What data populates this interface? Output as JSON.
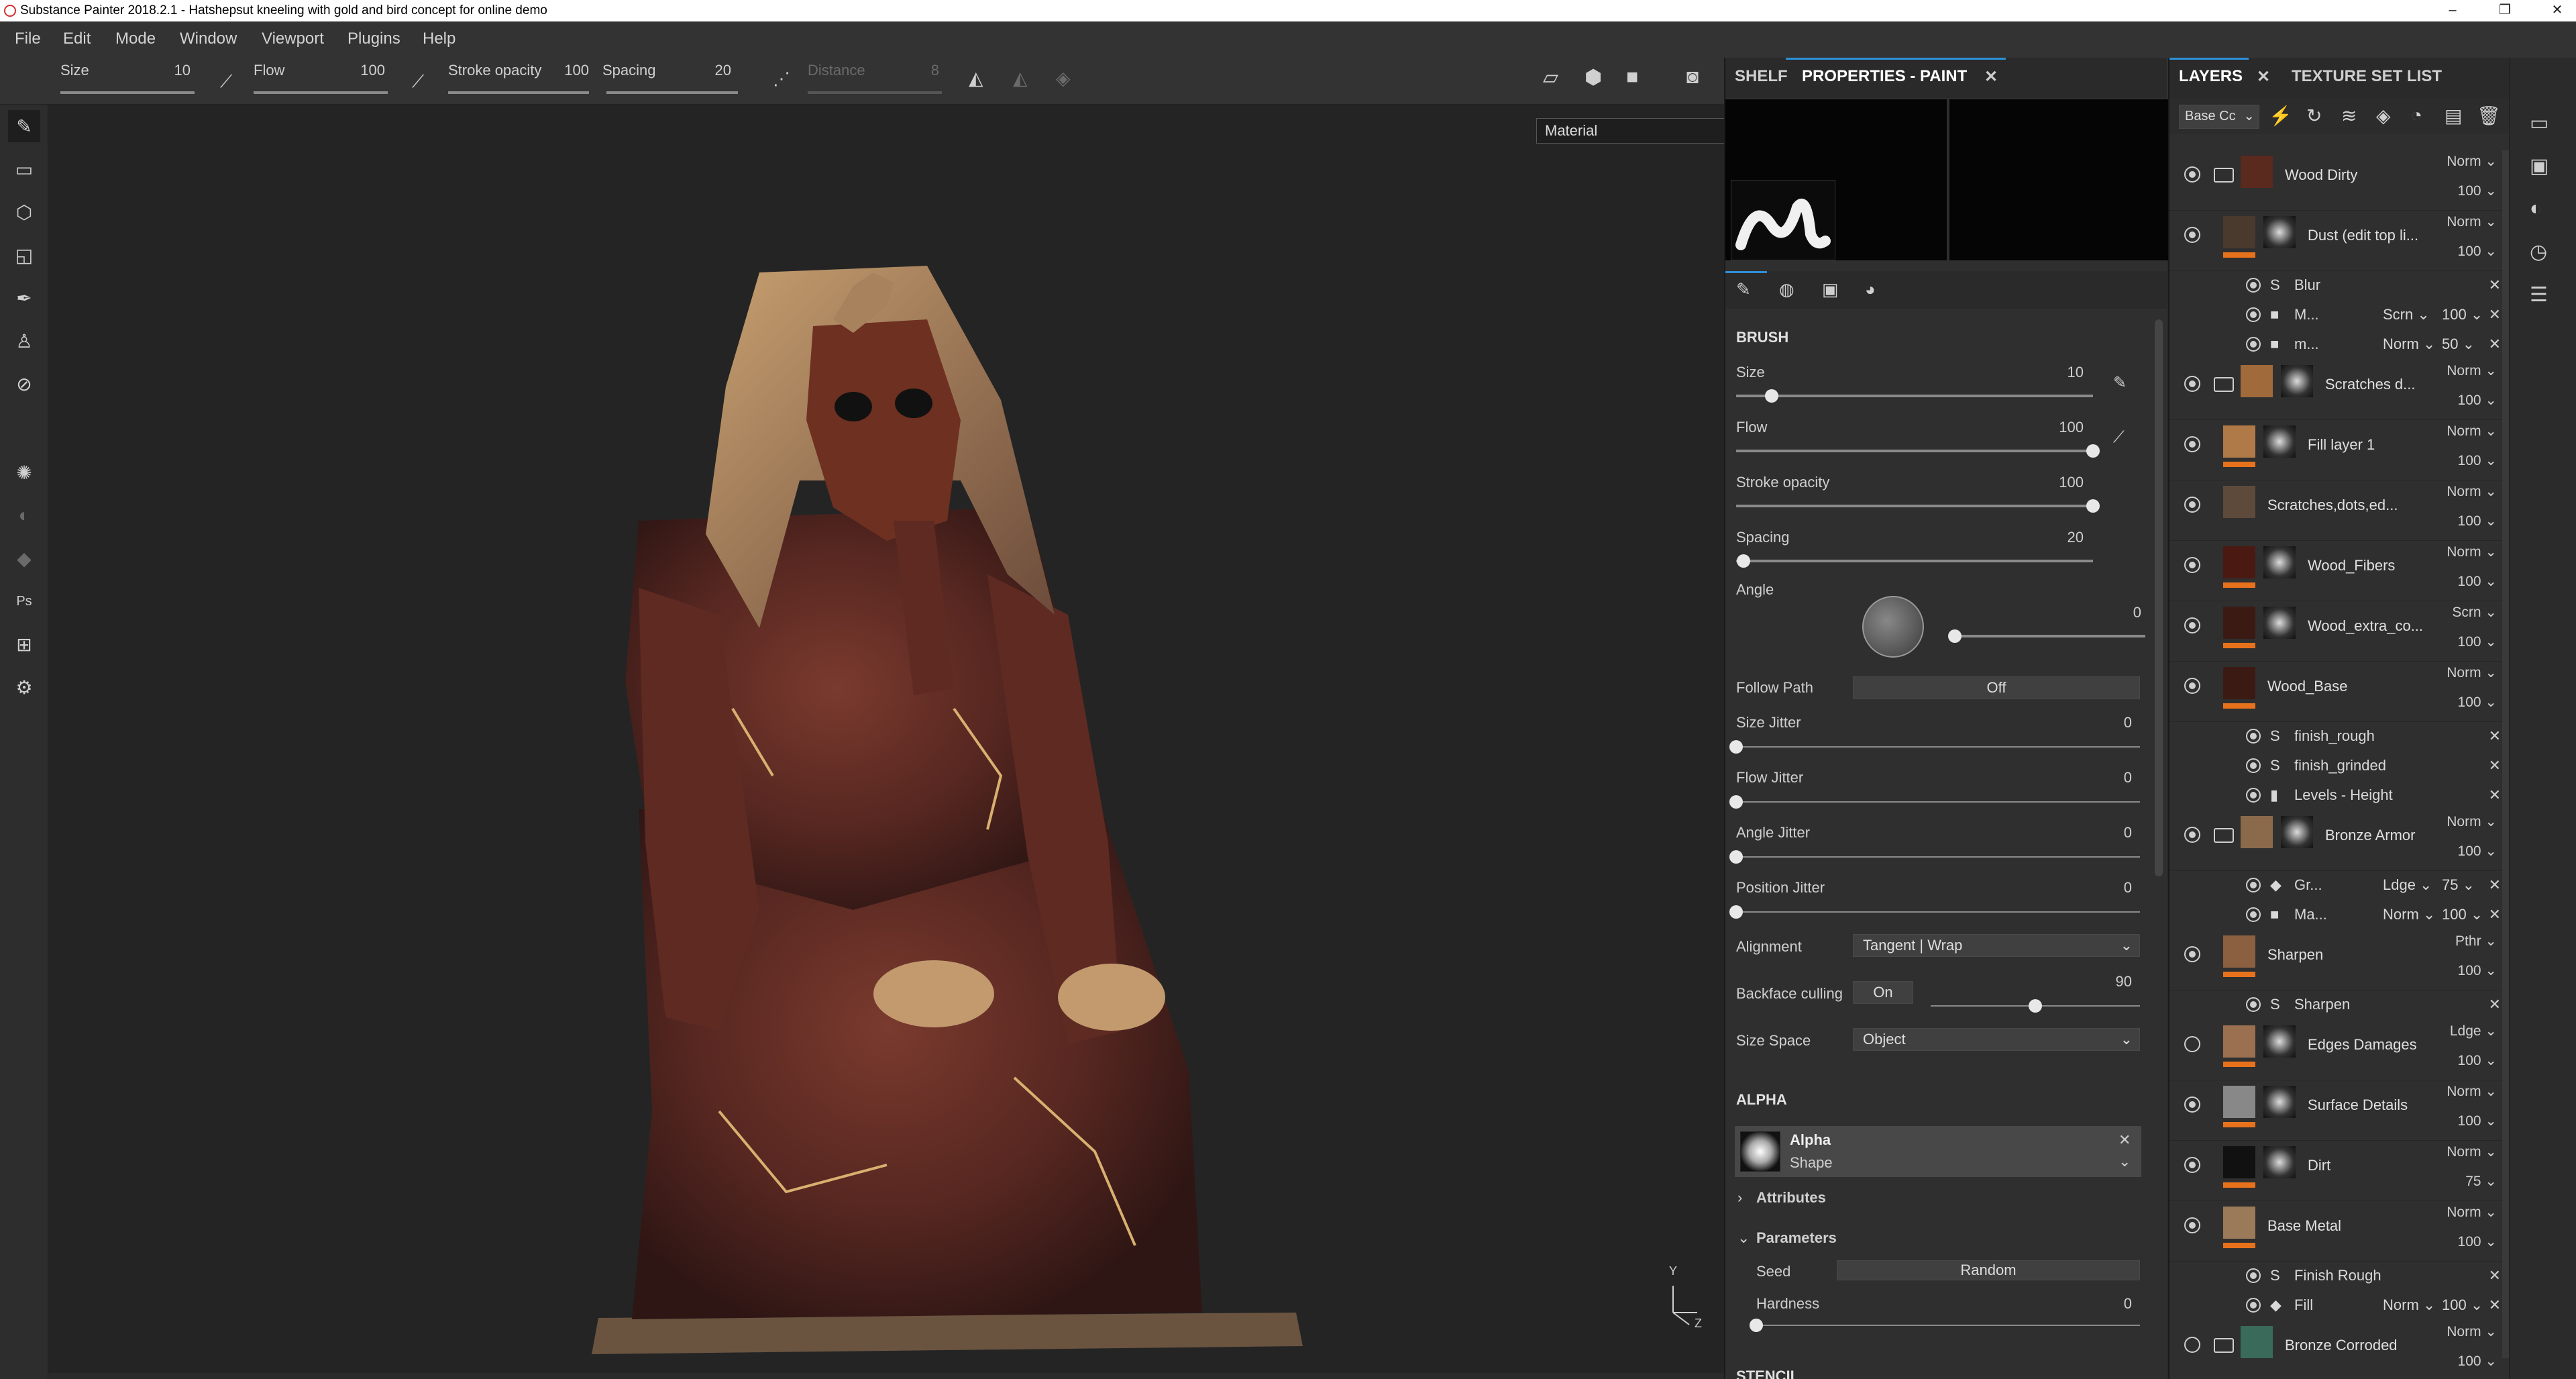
{
  "window": {
    "title": "Substance Painter 2018.2.1 - Hatshepsut kneeling with gold and bird concept for online demo",
    "minimize": "–",
    "restore": "❐",
    "close": "✕"
  },
  "menu": [
    "File",
    "Edit",
    "Mode",
    "Window",
    "Viewport",
    "Plugins",
    "Help"
  ],
  "tool_options": {
    "size_label": "Size",
    "size_value": "10",
    "size_level": 0.1,
    "flow_label": "Flow",
    "flow_value": "100",
    "flow_level": 1.0,
    "stroke_opacity_label": "Stroke opacity",
    "stroke_opacity_value": "100",
    "stroke_opacity_level": 1.0,
    "spacing_label": "Spacing",
    "spacing_value": "20",
    "spacing_level": 0.2,
    "distance_label": "Distance",
    "distance_value": "8",
    "distance_level": 0.08
  },
  "viewport": {
    "channel_select": "Material",
    "axis_y": "Y",
    "axis_z": "Z"
  },
  "shelf_panel": {
    "tab_shelf": "SHELF",
    "tab_properties": "PROPERTIES - PAINT",
    "brush_header": "BRUSH",
    "params": [
      {
        "label": "Size",
        "value": "10",
        "level": 0.1
      },
      {
        "label": "Flow",
        "value": "100",
        "level": 1.0
      },
      {
        "label": "Stroke opacity",
        "value": "100",
        "level": 1.0
      },
      {
        "label": "Spacing",
        "value": "20",
        "level": 0.02
      }
    ],
    "angle_label": "Angle",
    "angle_value": "0",
    "follow_path_label": "Follow Path",
    "follow_path_value": "Off",
    "jitters": [
      {
        "label": "Size Jitter",
        "value": "0",
        "level": 0
      },
      {
        "label": "Flow Jitter",
        "value": "0",
        "level": 0
      },
      {
        "label": "Angle Jitter",
        "value": "0",
        "level": 0
      },
      {
        "label": "Position Jitter",
        "value": "0",
        "level": 0
      }
    ],
    "alignment_label": "Alignment",
    "alignment_value": "Tangent | Wrap",
    "backface_label": "Backface culling",
    "backface_toggle": "On",
    "backface_value": "90",
    "backface_level": 0.5,
    "size_space_label": "Size Space",
    "size_space_value": "Object",
    "alpha_header": "ALPHA",
    "alpha_name": "Alpha",
    "alpha_sub": "Shape",
    "attributes_label": "Attributes",
    "parameters_label": "Parameters",
    "seed_label": "Seed",
    "seed_value": "Random",
    "hardness_label": "Hardness",
    "hardness_value": "0",
    "hardness_level": 0,
    "stencil_header": "STENCIL"
  },
  "layers_panel": {
    "tab_layers": "LAYERS",
    "tab_texture_sets": "TEXTURE SET LIST",
    "channel_select": "Base Cc",
    "items": [
      {
        "kind": "layer",
        "name": "Wood Dirty",
        "blend": "Norm",
        "opacity": "100",
        "visible": true,
        "folder": true,
        "thumb": "#5a2a1e",
        "mask": false,
        "orange": false
      },
      {
        "kind": "layer",
        "name": "Dust (edit top li...",
        "blend": "Norm",
        "opacity": "100",
        "visible": true,
        "folder": false,
        "thumb": "#4a3a2e",
        "mask": true,
        "orange": true
      },
      {
        "kind": "effect",
        "name": "Blur",
        "blend": "",
        "opacity": "",
        "icon": "S"
      },
      {
        "kind": "effect",
        "name": "M...",
        "blend": "Scrn",
        "opacity": "100",
        "icon": "■"
      },
      {
        "kind": "effect",
        "name": "m...",
        "blend": "Norm",
        "opacity": "50",
        "icon": "■"
      },
      {
        "kind": "layer",
        "name": "Scratches d...",
        "blend": "Norm",
        "opacity": "100",
        "visible": true,
        "folder": true,
        "thumb": "#a06a3a",
        "mask": true,
        "orange": false
      },
      {
        "kind": "layer",
        "name": "Fill layer 1",
        "blend": "Norm",
        "opacity": "100",
        "visible": true,
        "folder": false,
        "thumb": "#b07a48",
        "mask": true,
        "orange": true
      },
      {
        "kind": "layer",
        "name": "Scratches,dots,ed...",
        "blend": "Norm",
        "opacity": "100",
        "visible": true,
        "folder": false,
        "thumb": "#5e4a3a",
        "mask": false,
        "orange": false
      },
      {
        "kind": "layer",
        "name": "Wood_Fibers",
        "blend": "Norm",
        "opacity": "100",
        "visible": true,
        "folder": false,
        "thumb": "#4a1a12",
        "mask": true,
        "orange": true
      },
      {
        "kind": "layer",
        "name": "Wood_extra_co...",
        "blend": "Scrn",
        "opacity": "100",
        "visible": true,
        "folder": false,
        "thumb": "#3a1a12",
        "mask": true,
        "orange": true
      },
      {
        "kind": "layer",
        "name": "Wood_Base",
        "blend": "Norm",
        "opacity": "100",
        "visible": true,
        "folder": false,
        "thumb": "#3c1a14",
        "mask": false,
        "orange": true
      },
      {
        "kind": "effect",
        "name": "finish_rough",
        "blend": "",
        "opacity": "",
        "icon": "S"
      },
      {
        "kind": "effect",
        "name": "finish_grinded",
        "blend": "",
        "opacity": "",
        "icon": "S"
      },
      {
        "kind": "effect",
        "name": "Levels - Height",
        "blend": "",
        "opacity": "",
        "icon": "▮"
      },
      {
        "kind": "layer",
        "name": "Bronze Armor",
        "blend": "Norm",
        "opacity": "100",
        "visible": true,
        "folder": true,
        "thumb": "#8a6a4a",
        "mask": true,
        "orange": false
      },
      {
        "kind": "effect",
        "name": "Gr...",
        "blend": "Ldge",
        "opacity": "75",
        "icon": "◆"
      },
      {
        "kind": "effect",
        "name": "Ma...",
        "blend": "Norm",
        "opacity": "100",
        "icon": "■"
      },
      {
        "kind": "layer",
        "name": "Sharpen",
        "blend": "Pthr",
        "opacity": "100",
        "visible": true,
        "folder": false,
        "thumb": "#8a6040",
        "mask": false,
        "orange": true
      },
      {
        "kind": "effect",
        "name": "Sharpen",
        "blend": "",
        "opacity": "",
        "icon": "S"
      },
      {
        "kind": "layer",
        "name": "Edges Damages",
        "blend": "Ldge",
        "opacity": "100",
        "visible": false,
        "folder": false,
        "thumb": "#9a7050",
        "mask": true,
        "orange": true
      },
      {
        "kind": "layer",
        "name": "Surface Details",
        "blend": "Norm",
        "opacity": "100",
        "visible": true,
        "folder": false,
        "thumb": "#888888",
        "mask": true,
        "orange": true
      },
      {
        "kind": "layer",
        "name": "Dirt",
        "blend": "Norm",
        "opacity": "75",
        "visible": true,
        "folder": false,
        "thumb": "#111111",
        "mask": true,
        "orange": true
      },
      {
        "kind": "layer",
        "name": "Base Metal",
        "blend": "Norm",
        "opacity": "100",
        "visible": true,
        "folder": false,
        "thumb": "#9a7a58",
        "mask": false,
        "orange": true
      },
      {
        "kind": "effect",
        "name": "Finish Rough",
        "blend": "",
        "opacity": "",
        "icon": "S"
      },
      {
        "kind": "effect",
        "name": "Fill",
        "blend": "Norm",
        "opacity": "100",
        "icon": "◆"
      },
      {
        "kind": "layer",
        "name": "Bronze Corroded",
        "blend": "Norm",
        "opacity": "100",
        "visible": false,
        "folder": true,
        "thumb": "#3a6a5a",
        "mask": false,
        "orange": false
      }
    ]
  },
  "colors": {
    "accent": "#2f8fd8",
    "mask_bar": "#e8721c"
  }
}
